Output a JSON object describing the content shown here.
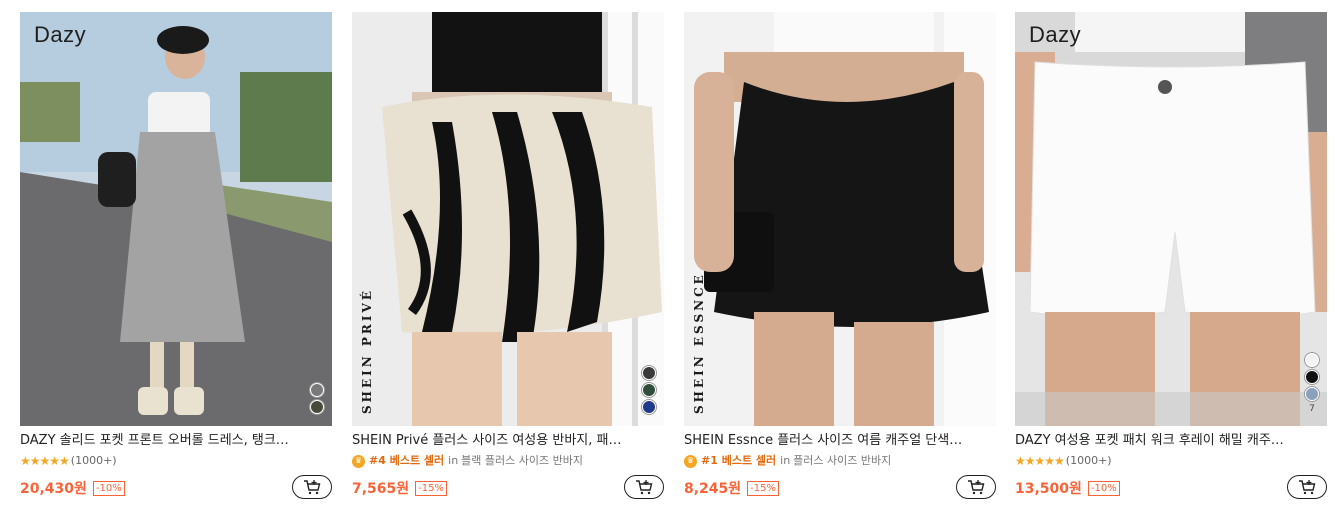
{
  "products": [
    {
      "brand_mark": "Dazy",
      "vertical_brand": "",
      "title": "DAZY 솔리드 포켓 프론트 오버롤 드레스, 탱크…",
      "rating": "(1000+)",
      "best_rank": "",
      "best_in": "",
      "category": "",
      "price": "20,430원",
      "discount": "-10%",
      "swatches": [
        "#7a7a7a",
        "#4a4a3a"
      ],
      "swatch_more": "",
      "image_colors": {
        "bg": "#b9c7d4",
        "ground": "#6f6f72",
        "subject": "#9a9a9a"
      }
    },
    {
      "brand_mark": "",
      "vertical_brand": "SHEIN PRIVÉ",
      "title": "SHEIN Privé 플러스 사이즈 여성용 반바지, 패…",
      "rating": "",
      "best_rank": "#4 베스트 셀러",
      "best_in": "in",
      "category": "블랙 플러스 사이즈 반바지",
      "price": "7,565원",
      "discount": "-15%",
      "swatches": [
        "#3a3a3a",
        "#2f4d3d",
        "#1f3a8a"
      ],
      "swatch_more": "",
      "image_colors": {
        "bg": "#f1f1f1",
        "ground": "#d9cbbd",
        "subject": "#1a1a1a"
      }
    },
    {
      "brand_mark": "",
      "vertical_brand": "SHEIN ESSNCE",
      "title": "SHEIN Essnce 플러스 사이즈 여름 캐주얼 단색…",
      "rating": "",
      "best_rank": "#1 베스트 셀러",
      "best_in": "in",
      "category": "플러스 사이즈 반바지",
      "price": "8,245원",
      "discount": "-15%",
      "swatches": [],
      "swatch_more": "",
      "image_colors": {
        "bg": "#efefef",
        "ground": "#c9a48a",
        "subject": "#111111"
      }
    },
    {
      "brand_mark": "Dazy",
      "vertical_brand": "",
      "title": "DAZY 여성용 포켓 패치 워크 후레이 해밀 캐주…",
      "rating": "(1000+)",
      "best_rank": "",
      "best_in": "",
      "category": "",
      "price": "13,500원",
      "discount": "-10%",
      "swatches": [
        "#f4f4f4",
        "#111111",
        "#8aa0bd"
      ],
      "swatch_more": "7",
      "image_colors": {
        "bg": "#e6e6e6",
        "ground": "#d8ad92",
        "subject": "#fbfbfb"
      }
    }
  ]
}
